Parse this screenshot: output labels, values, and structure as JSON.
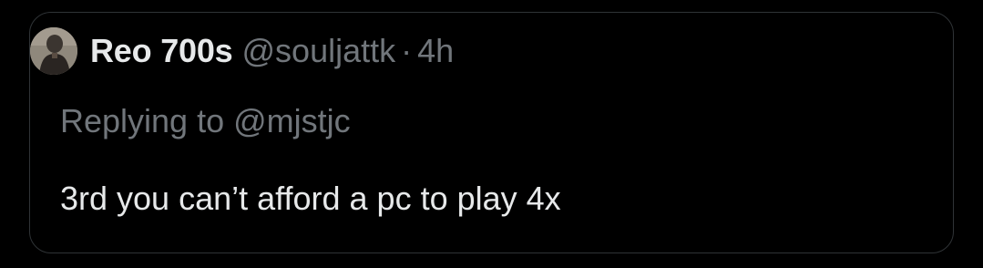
{
  "quote": {
    "author": {
      "display_name": "Reo 700s",
      "handle": "@souljattk",
      "separator": "·",
      "timestamp": "4h",
      "avatar_icon": "user-avatar-photo"
    },
    "reply_prefix": "Replying to",
    "reply_to": "@mjstjc",
    "text": "3rd you can’t afford a pc to play 4x"
  },
  "colors": {
    "background": "#000000",
    "border": "#2f3336",
    "primary_text": "#e7e9ea",
    "secondary_text": "#71767b"
  }
}
